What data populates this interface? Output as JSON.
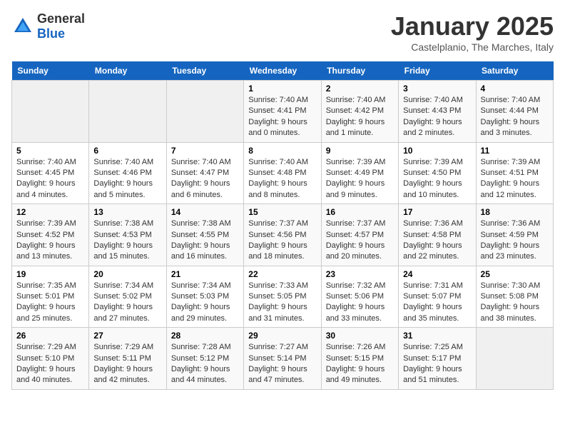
{
  "logo": {
    "general": "General",
    "blue": "Blue"
  },
  "title": "January 2025",
  "subtitle": "Castelplanio, The Marches, Italy",
  "days_of_week": [
    "Sunday",
    "Monday",
    "Tuesday",
    "Wednesday",
    "Thursday",
    "Friday",
    "Saturday"
  ],
  "weeks": [
    [
      {
        "day": "",
        "info": ""
      },
      {
        "day": "",
        "info": ""
      },
      {
        "day": "",
        "info": ""
      },
      {
        "day": "1",
        "info": "Sunrise: 7:40 AM\nSunset: 4:41 PM\nDaylight: 9 hours and 0 minutes."
      },
      {
        "day": "2",
        "info": "Sunrise: 7:40 AM\nSunset: 4:42 PM\nDaylight: 9 hours and 1 minute."
      },
      {
        "day": "3",
        "info": "Sunrise: 7:40 AM\nSunset: 4:43 PM\nDaylight: 9 hours and 2 minutes."
      },
      {
        "day": "4",
        "info": "Sunrise: 7:40 AM\nSunset: 4:44 PM\nDaylight: 9 hours and 3 minutes."
      }
    ],
    [
      {
        "day": "5",
        "info": "Sunrise: 7:40 AM\nSunset: 4:45 PM\nDaylight: 9 hours and 4 minutes."
      },
      {
        "day": "6",
        "info": "Sunrise: 7:40 AM\nSunset: 4:46 PM\nDaylight: 9 hours and 5 minutes."
      },
      {
        "day": "7",
        "info": "Sunrise: 7:40 AM\nSunset: 4:47 PM\nDaylight: 9 hours and 6 minutes."
      },
      {
        "day": "8",
        "info": "Sunrise: 7:40 AM\nSunset: 4:48 PM\nDaylight: 9 hours and 8 minutes."
      },
      {
        "day": "9",
        "info": "Sunrise: 7:39 AM\nSunset: 4:49 PM\nDaylight: 9 hours and 9 minutes."
      },
      {
        "day": "10",
        "info": "Sunrise: 7:39 AM\nSunset: 4:50 PM\nDaylight: 9 hours and 10 minutes."
      },
      {
        "day": "11",
        "info": "Sunrise: 7:39 AM\nSunset: 4:51 PM\nDaylight: 9 hours and 12 minutes."
      }
    ],
    [
      {
        "day": "12",
        "info": "Sunrise: 7:39 AM\nSunset: 4:52 PM\nDaylight: 9 hours and 13 minutes."
      },
      {
        "day": "13",
        "info": "Sunrise: 7:38 AM\nSunset: 4:53 PM\nDaylight: 9 hours and 15 minutes."
      },
      {
        "day": "14",
        "info": "Sunrise: 7:38 AM\nSunset: 4:55 PM\nDaylight: 9 hours and 16 minutes."
      },
      {
        "day": "15",
        "info": "Sunrise: 7:37 AM\nSunset: 4:56 PM\nDaylight: 9 hours and 18 minutes."
      },
      {
        "day": "16",
        "info": "Sunrise: 7:37 AM\nSunset: 4:57 PM\nDaylight: 9 hours and 20 minutes."
      },
      {
        "day": "17",
        "info": "Sunrise: 7:36 AM\nSunset: 4:58 PM\nDaylight: 9 hours and 22 minutes."
      },
      {
        "day": "18",
        "info": "Sunrise: 7:36 AM\nSunset: 4:59 PM\nDaylight: 9 hours and 23 minutes."
      }
    ],
    [
      {
        "day": "19",
        "info": "Sunrise: 7:35 AM\nSunset: 5:01 PM\nDaylight: 9 hours and 25 minutes."
      },
      {
        "day": "20",
        "info": "Sunrise: 7:34 AM\nSunset: 5:02 PM\nDaylight: 9 hours and 27 minutes."
      },
      {
        "day": "21",
        "info": "Sunrise: 7:34 AM\nSunset: 5:03 PM\nDaylight: 9 hours and 29 minutes."
      },
      {
        "day": "22",
        "info": "Sunrise: 7:33 AM\nSunset: 5:05 PM\nDaylight: 9 hours and 31 minutes."
      },
      {
        "day": "23",
        "info": "Sunrise: 7:32 AM\nSunset: 5:06 PM\nDaylight: 9 hours and 33 minutes."
      },
      {
        "day": "24",
        "info": "Sunrise: 7:31 AM\nSunset: 5:07 PM\nDaylight: 9 hours and 35 minutes."
      },
      {
        "day": "25",
        "info": "Sunrise: 7:30 AM\nSunset: 5:08 PM\nDaylight: 9 hours and 38 minutes."
      }
    ],
    [
      {
        "day": "26",
        "info": "Sunrise: 7:29 AM\nSunset: 5:10 PM\nDaylight: 9 hours and 40 minutes."
      },
      {
        "day": "27",
        "info": "Sunrise: 7:29 AM\nSunset: 5:11 PM\nDaylight: 9 hours and 42 minutes."
      },
      {
        "day": "28",
        "info": "Sunrise: 7:28 AM\nSunset: 5:12 PM\nDaylight: 9 hours and 44 minutes."
      },
      {
        "day": "29",
        "info": "Sunrise: 7:27 AM\nSunset: 5:14 PM\nDaylight: 9 hours and 47 minutes."
      },
      {
        "day": "30",
        "info": "Sunrise: 7:26 AM\nSunset: 5:15 PM\nDaylight: 9 hours and 49 minutes."
      },
      {
        "day": "31",
        "info": "Sunrise: 7:25 AM\nSunset: 5:17 PM\nDaylight: 9 hours and 51 minutes."
      },
      {
        "day": "",
        "info": ""
      }
    ]
  ]
}
